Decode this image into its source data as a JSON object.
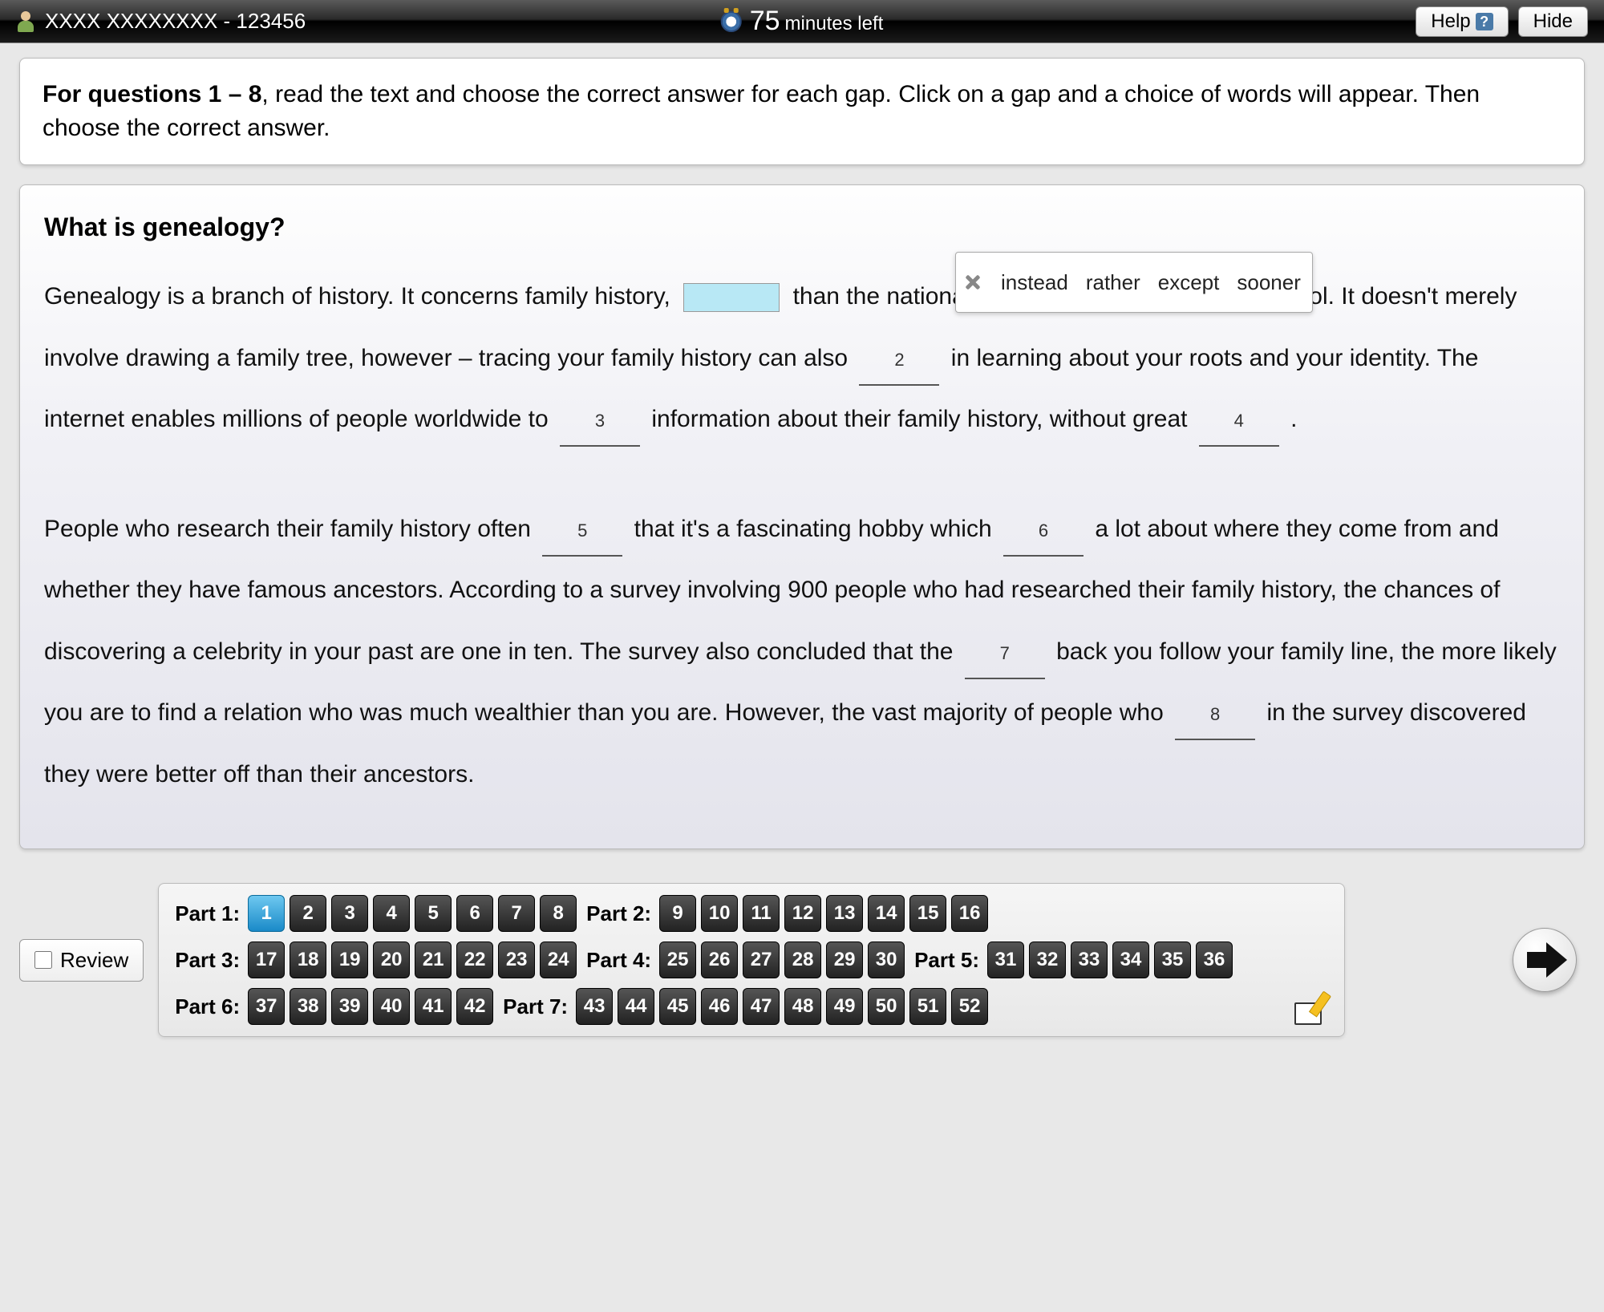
{
  "header": {
    "user_name": "XXXX XXXXXXXX - 123456",
    "timer_value": "75",
    "timer_label": "minutes left",
    "help_label": "Help",
    "hide_label": "Hide"
  },
  "instructions": {
    "bold": "For questions 1 – 8",
    "rest": ", read the text and choose the correct answer for each gap. Click on a gap and a choice of words will appear. Then choose the correct answer."
  },
  "passage": {
    "title": "What is genealogy?",
    "seg1": "Genealogy is a branch of history.  It concerns family history, ",
    "seg2": " than the national or world history studied at school.  It doesn't merely involve drawing a family tree, however – tracing your family history can also ",
    "seg3": " in learning about your roots and your identity.  The internet enables millions of people worldwide to ",
    "seg4": " information about their family history, without great ",
    "seg5": " .",
    "seg6": "People who research their family history often ",
    "seg7": " that it's a fascinating hobby which ",
    "seg8": " a lot about where they come from and whether they have famous ancestors.  According to a survey involving 900 people who had researched their family history, the chances of discovering a celebrity in your past are one in ten.  The survey also concluded that the ",
    "seg9": " back you follow your family line, the more likely you are to find a relation who was much wealthier than you are.  However, the vast majority of people who ",
    "seg10": " in the survey discovered they were better off than their ancestors."
  },
  "gap_labels": {
    "g2": "2",
    "g3": "3",
    "g4": "4",
    "g5": "5",
    "g6": "6",
    "g7": "7",
    "g8": "8"
  },
  "popup": {
    "choices": [
      "instead",
      "rather",
      "except",
      "sooner"
    ]
  },
  "review_label": "Review",
  "nav": {
    "parts": [
      {
        "label": "Part 1:",
        "start": 1,
        "end": 8
      },
      {
        "label": "Part 2:",
        "start": 9,
        "end": 16
      },
      {
        "label": "Part 3:",
        "start": 17,
        "end": 24
      },
      {
        "label": "Part 4:",
        "start": 25,
        "end": 30
      },
      {
        "label": "Part 5:",
        "start": 31,
        "end": 36
      },
      {
        "label": "Part 6:",
        "start": 37,
        "end": 42
      },
      {
        "label": "Part 7:",
        "start": 43,
        "end": 52
      }
    ],
    "current": 1
  }
}
